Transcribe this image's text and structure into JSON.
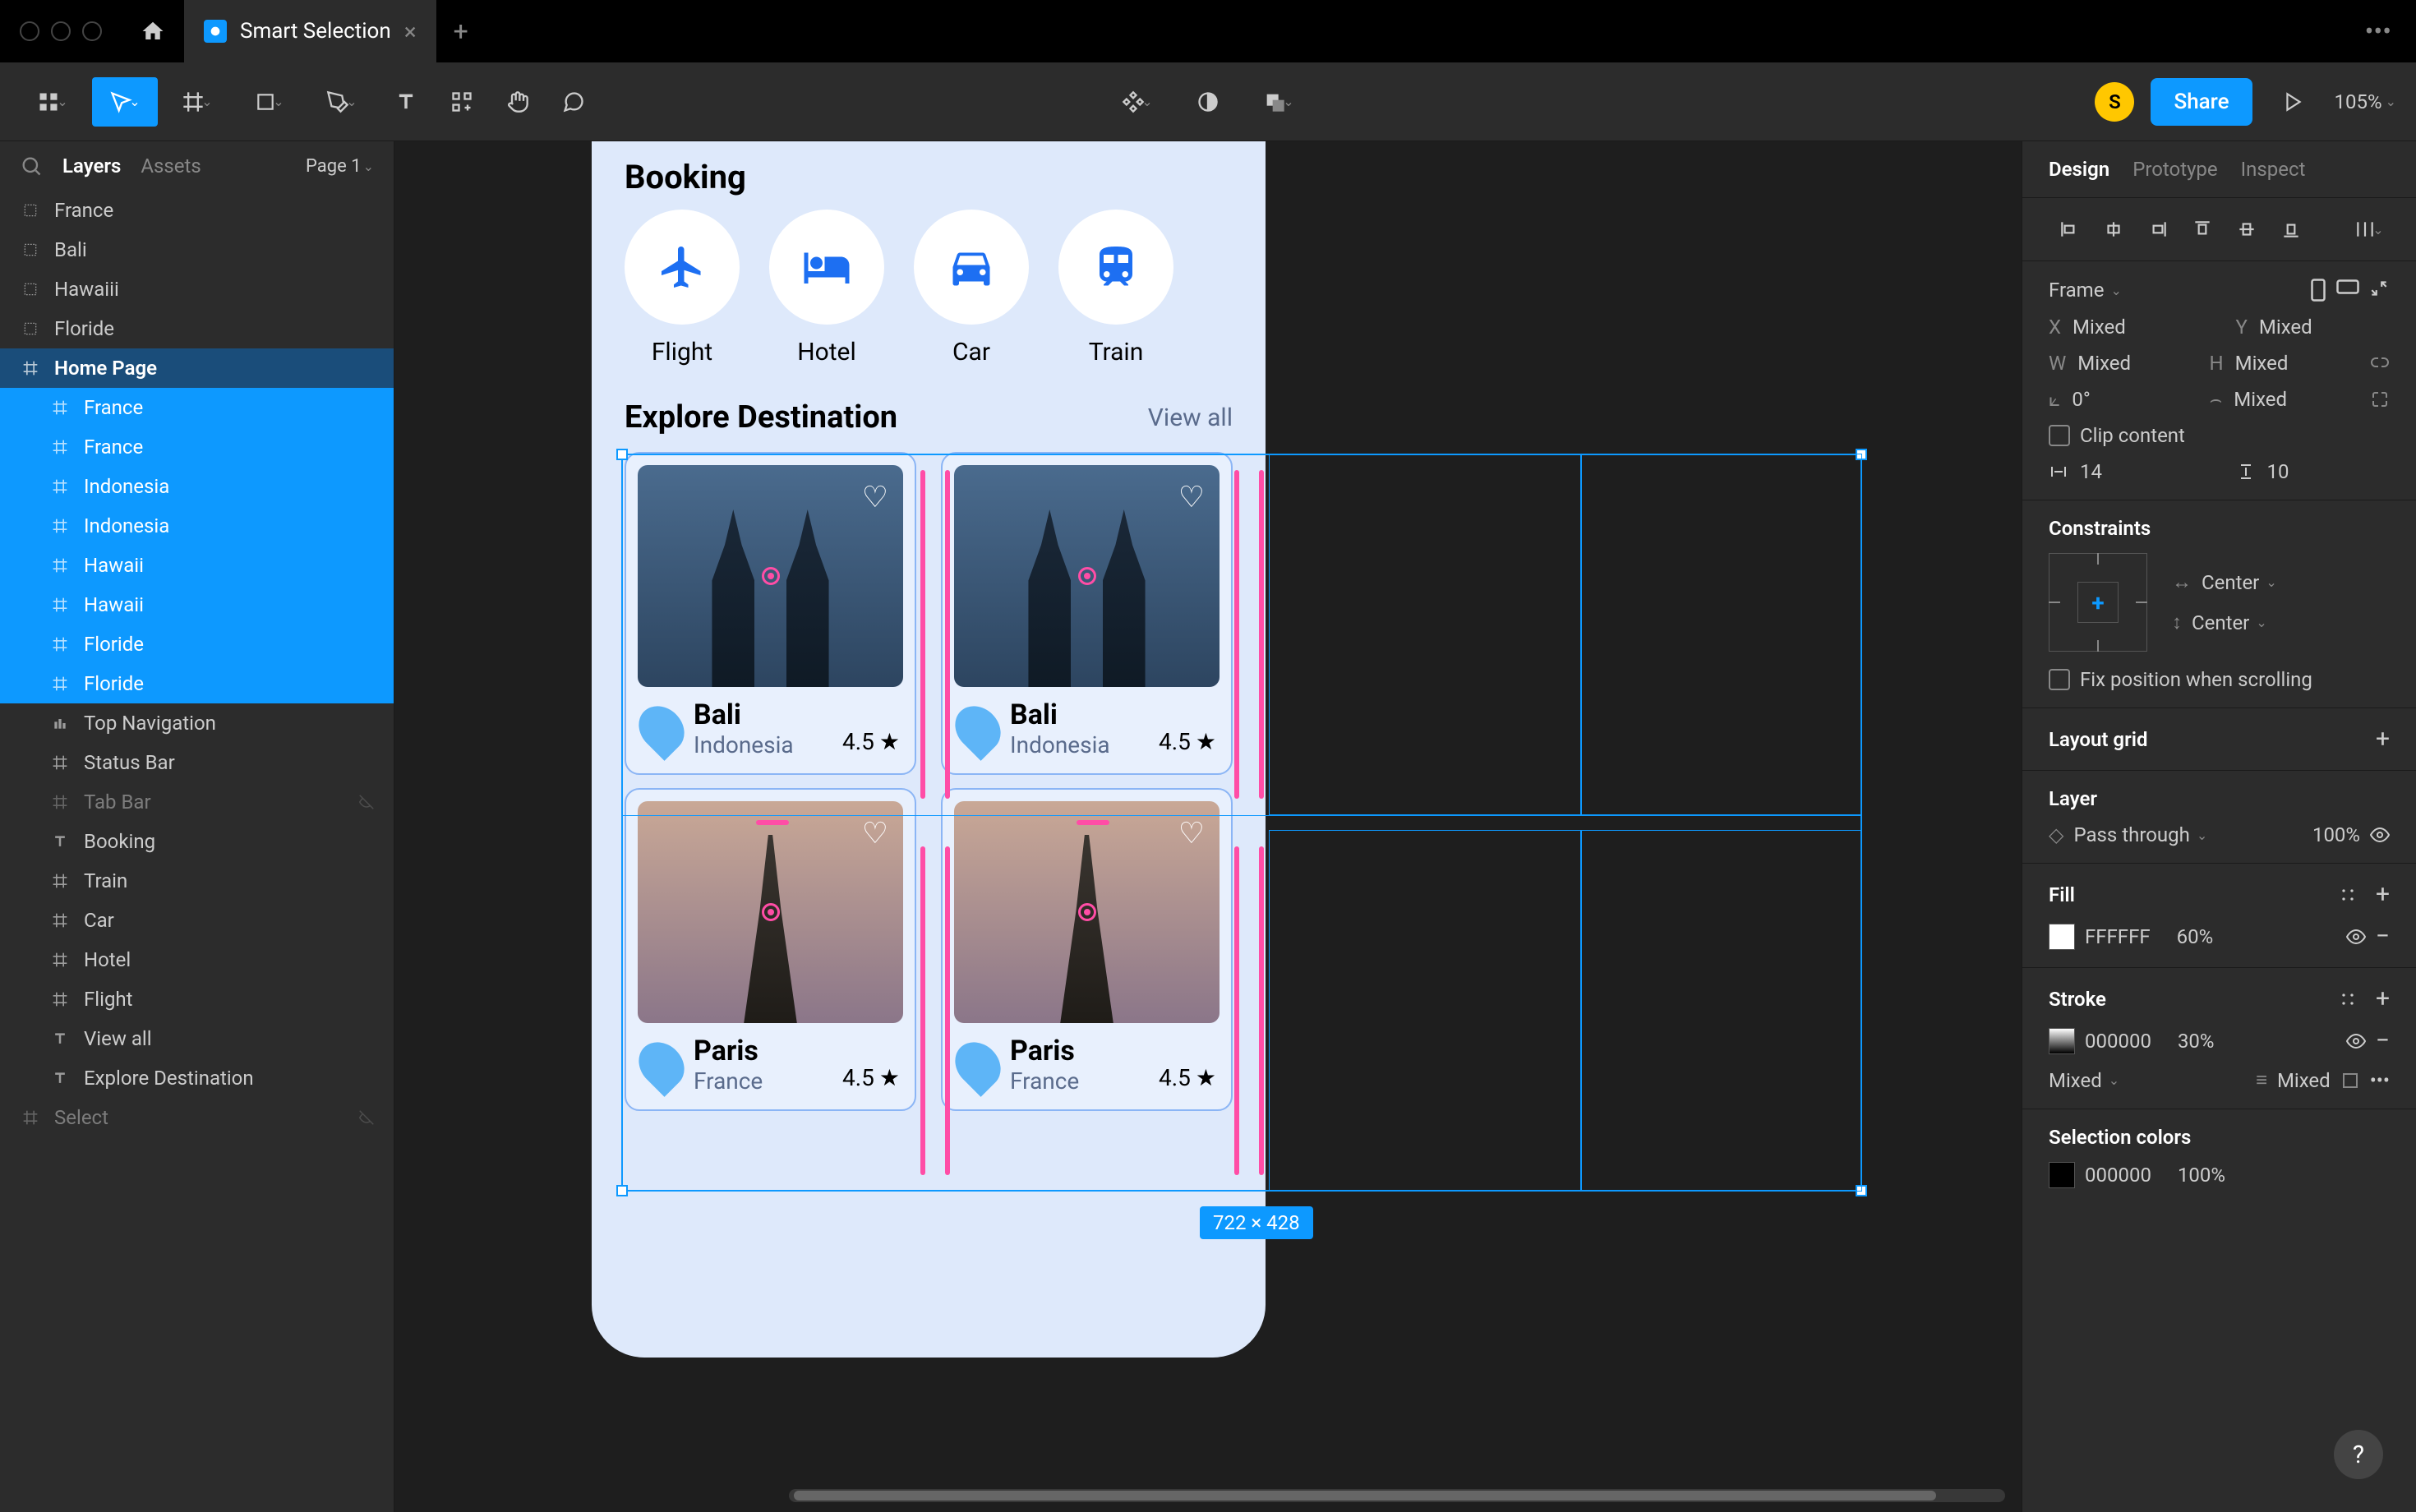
{
  "chrome": {
    "tab_title": "Smart Selection",
    "menu_dots": "•••"
  },
  "toolbar": {
    "avatar_letter": "S",
    "share_label": "Share",
    "zoom": "105%"
  },
  "left_panel": {
    "tabs": {
      "layers": "Layers",
      "assets": "Assets"
    },
    "page": "Page 1",
    "layers": [
      {
        "icon": "frame-dots",
        "label": "France",
        "indent": 0
      },
      {
        "icon": "frame-dots",
        "label": "Bali",
        "indent": 0
      },
      {
        "icon": "frame-dots",
        "label": "Hawaiii",
        "indent": 0
      },
      {
        "icon": "frame-dots",
        "label": "Floride",
        "indent": 0
      },
      {
        "icon": "frame",
        "label": "Home Page",
        "indent": 0,
        "bold": true
      },
      {
        "icon": "frame",
        "label": "France",
        "indent": 1,
        "sel": true
      },
      {
        "icon": "frame",
        "label": "France",
        "indent": 1,
        "sel": true
      },
      {
        "icon": "frame",
        "label": "Indonesia",
        "indent": 1,
        "sel": true
      },
      {
        "icon": "frame",
        "label": "Indonesia",
        "indent": 1,
        "sel": true
      },
      {
        "icon": "frame",
        "label": "Hawaii",
        "indent": 1,
        "sel": true
      },
      {
        "icon": "frame",
        "label": "Hawaii",
        "indent": 1,
        "sel": true
      },
      {
        "icon": "frame",
        "label": "Floride",
        "indent": 1,
        "sel": true
      },
      {
        "icon": "frame",
        "label": "Floride",
        "indent": 1,
        "sel": true
      },
      {
        "icon": "bars",
        "label": "Top Navigation",
        "indent": 1
      },
      {
        "icon": "frame",
        "label": "Status Bar",
        "indent": 1
      },
      {
        "icon": "frame",
        "label": "Tab Bar",
        "indent": 1,
        "faded": true
      },
      {
        "icon": "text",
        "label": "Booking",
        "indent": 1
      },
      {
        "icon": "frame",
        "label": "Train",
        "indent": 1
      },
      {
        "icon": "frame",
        "label": "Car",
        "indent": 1
      },
      {
        "icon": "frame",
        "label": "Hotel",
        "indent": 1
      },
      {
        "icon": "frame",
        "label": "Flight",
        "indent": 1
      },
      {
        "icon": "text",
        "label": "View all",
        "indent": 1
      },
      {
        "icon": "text",
        "label": "Explore Destination",
        "indent": 1
      },
      {
        "icon": "frame",
        "label": "Select",
        "indent": 0,
        "faded": true
      }
    ]
  },
  "canvas": {
    "booking_header": "Booking",
    "booking_items": [
      {
        "label": "Flight"
      },
      {
        "label": "Hotel"
      },
      {
        "label": "Car"
      },
      {
        "label": "Train"
      }
    ],
    "explore_title": "Explore Destination",
    "view_all": "View all",
    "cards": [
      {
        "name": "Bali",
        "sub": "Indonesia",
        "rating": "4.5",
        "img": "bali"
      },
      {
        "name": "Bali",
        "sub": "Indonesia",
        "rating": "4.5",
        "img": "bali"
      },
      {
        "name": "Paris",
        "sub": "France",
        "rating": "4.5",
        "img": "paris"
      },
      {
        "name": "Paris",
        "sub": "France",
        "rating": "4.5",
        "img": "paris"
      }
    ],
    "dimensions_label": "722 × 428"
  },
  "right_panel": {
    "tabs": {
      "design": "Design",
      "prototype": "Prototype",
      "inspect": "Inspect"
    },
    "frame": {
      "label": "Frame",
      "x": "Mixed",
      "y": "Mixed",
      "w": "Mixed",
      "h": "Mixed",
      "rotation": "0°",
      "radius": "Mixed",
      "clip_content": "Clip content",
      "hspace": "14",
      "vspace": "10"
    },
    "constraints": {
      "title": "Constraints",
      "h": "Center",
      "v": "Center",
      "fix_scroll": "Fix position when scrolling"
    },
    "layout_grid": "Layout grid",
    "layer": {
      "title": "Layer",
      "blend": "Pass through",
      "opacity": "100%"
    },
    "fill": {
      "title": "Fill",
      "hex": "FFFFFF",
      "opacity": "60%"
    },
    "stroke": {
      "title": "Stroke",
      "hex": "000000",
      "opacity": "30%",
      "pos": "Mixed",
      "width": "Mixed"
    },
    "selection_colors": {
      "title": "Selection colors",
      "hex": "000000",
      "opacity": "100%"
    }
  }
}
